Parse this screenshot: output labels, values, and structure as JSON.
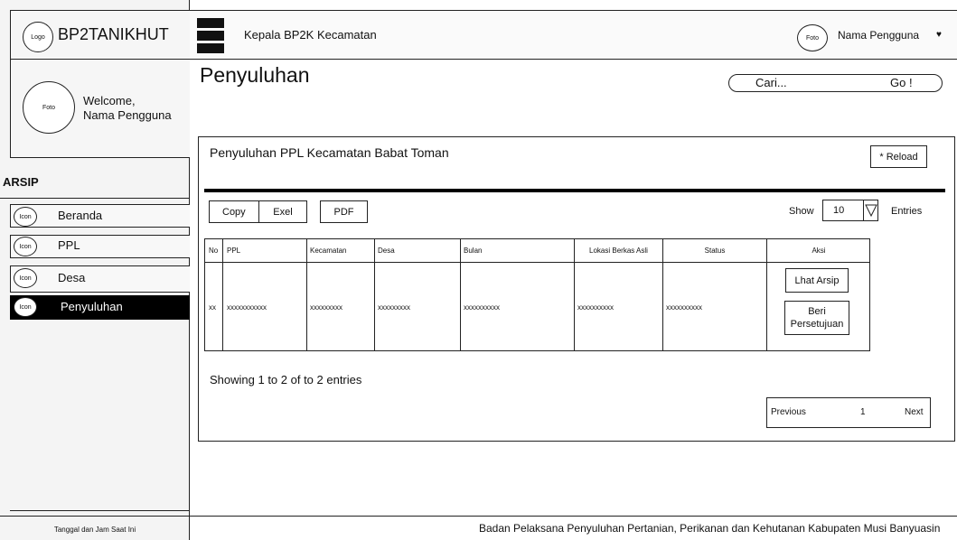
{
  "brand": {
    "logo_label": "Logo",
    "name": "BP2TANIKHUT"
  },
  "header": {
    "role_title": "Kepala BP2K Kecamatan",
    "user_photo_label": "Foto",
    "user_name": "Nama Pengguna"
  },
  "sidebar": {
    "photo_label": "Foto",
    "welcome": "Welcome,",
    "user_name": "Nama Pengguna",
    "section_title": "ARSIP",
    "items": [
      {
        "icon_label": "Icon",
        "label": "Beranda"
      },
      {
        "icon_label": "Icon",
        "label": "PPL"
      },
      {
        "icon_label": "Icon",
        "label": "Desa"
      },
      {
        "icon_label": "Icon",
        "label": "Penyuluhan"
      }
    ],
    "footer_datetime": "Tanggal dan Jam Saat Ini"
  },
  "page": {
    "title": "Penyuluhan"
  },
  "search": {
    "placeholder": "Cari...",
    "go_label": "Go !"
  },
  "panel": {
    "title": "Penyuluhan PPL Kecamatan Babat Toman",
    "reload_label": "* Reload",
    "export_buttons": {
      "copy": "Copy",
      "excel": "Exel",
      "pdf": "PDF"
    },
    "show_label": "Show",
    "entries_value": "10",
    "entries_label": "Entries",
    "table": {
      "columns": [
        "No",
        "PPL",
        "Kecamatan",
        "Desa",
        "Bulan",
        "Lokasi Berkas Asli",
        "Status",
        "Aksi"
      ],
      "rows": [
        {
          "no": "xx",
          "ppl": "xxxxxxxxxxx",
          "kecamatan": "xxxxxxxxx",
          "desa": "xxxxxxxxx",
          "bulan": "xxxxxxxxxx",
          "lokasi": "xxxxxxxxxx",
          "status": "xxxxxxxxxx"
        }
      ],
      "actions": {
        "view": "Lhat Arsip",
        "approve_line1": "Beri",
        "approve_line2": "Persetujuan"
      }
    },
    "info": "Showing 1 to 2 of to 2 entries",
    "pagination": {
      "previous": "Previous",
      "page": "1",
      "next": "Next"
    }
  },
  "footer": {
    "org": "Badan Pelaksana Penyuluhan Pertanian, Perikanan dan Kehutanan Kabupaten Musi Banyuasin"
  },
  "colors": {
    "active_item_bg": "#000000",
    "active_item_text": "#ffffff",
    "border": "#222222"
  }
}
